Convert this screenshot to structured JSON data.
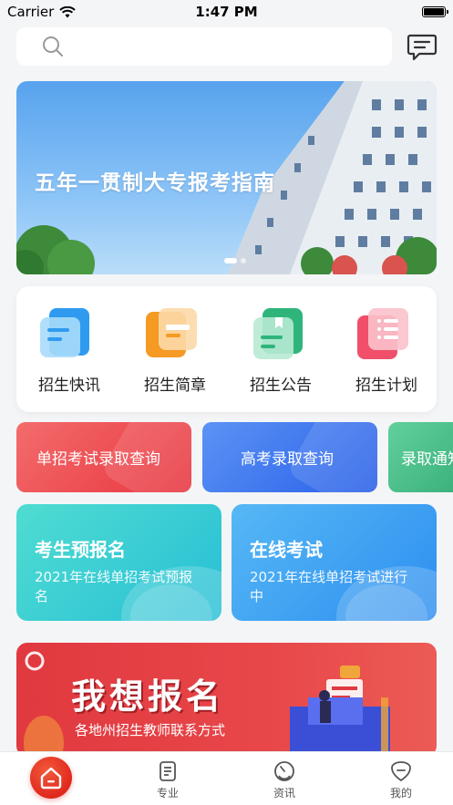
{
  "status_bar": {
    "carrier": "Carrier",
    "time": "1:47 PM"
  },
  "search": {
    "placeholder": ""
  },
  "banner": {
    "title": "五年一贯制大专报考指南"
  },
  "quick_nav": {
    "items": [
      {
        "label": "招生快讯",
        "icon": "news-flash-icon",
        "color": "#2f9bf0"
      },
      {
        "label": "招生简章",
        "icon": "brochure-icon",
        "color": "#f59a23"
      },
      {
        "label": "招生公告",
        "icon": "announcement-icon",
        "color": "#2fb57c"
      },
      {
        "label": "招生计划",
        "icon": "plan-list-icon",
        "color": "#f0506a"
      }
    ]
  },
  "query_chips": [
    {
      "label": "单招考试录取查询",
      "color": "#f0474f"
    },
    {
      "label": "高考录取查询",
      "color": "#2f6ef0"
    },
    {
      "label": "录取通知",
      "color": "#2fb57c"
    }
  ],
  "features": [
    {
      "title": "考生预报名",
      "desc": "2021年在线单招考试预报名",
      "color": "#3ccfcf"
    },
    {
      "title": "在线考试",
      "desc": "2021年在线单招考试进行中",
      "color": "#3aa3f0"
    }
  ],
  "promo": {
    "title": "我想报名",
    "subtitle": "各地州招生教师联系方式"
  },
  "tab_bar": {
    "items": [
      {
        "label": "",
        "icon": "home-icon"
      },
      {
        "label": "专业",
        "icon": "major-list-icon"
      },
      {
        "label": "资讯",
        "icon": "news-dial-icon"
      },
      {
        "label": "我的",
        "icon": "profile-icon"
      }
    ]
  }
}
